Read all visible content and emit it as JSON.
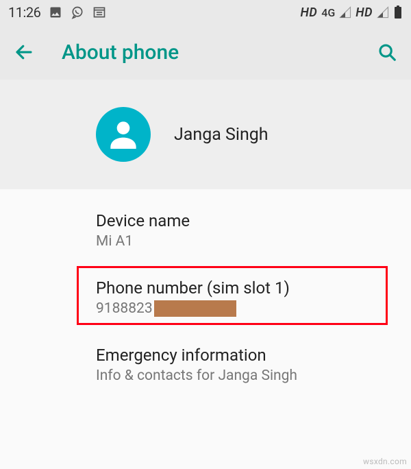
{
  "statusBar": {
    "time": "11:26",
    "hdLabel": "HD",
    "netLabel": "4G"
  },
  "appBar": {
    "title": "About phone"
  },
  "profile": {
    "name": "Janga Singh"
  },
  "items": {
    "deviceName": {
      "title": "Device name",
      "value": "Mi A1"
    },
    "phone": {
      "title": "Phone number (sim slot 1)",
      "valueVisible": "9188823"
    },
    "emergency": {
      "title": "Emergency information",
      "value": "Info & contacts for Janga Singh"
    }
  },
  "watermark": "wsxdn.com"
}
